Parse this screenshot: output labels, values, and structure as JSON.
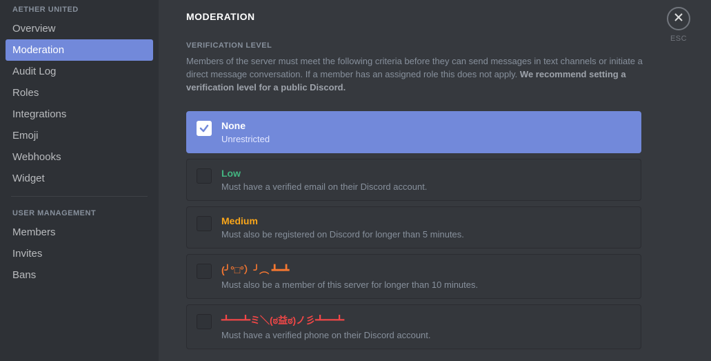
{
  "sidebar": {
    "header1": "AETHER UNITED",
    "items1": [
      "Overview",
      "Moderation",
      "Audit Log",
      "Roles",
      "Integrations",
      "Emoji",
      "Webhooks",
      "Widget"
    ],
    "activeIndex1": 1,
    "header2": "USER MANAGEMENT",
    "items2": [
      "Members",
      "Invites",
      "Bans"
    ]
  },
  "close": {
    "esc": "ESC"
  },
  "page": {
    "title": "MODERATION",
    "sectionTitle": "VERIFICATION LEVEL",
    "desc1": "Members of the server must meet the following criteria before they can send messages in text channels or initiate a direct message conversation. If a member has an assigned role this does not apply. ",
    "desc2": "We recommend setting a verification level for a public Discord."
  },
  "options": {
    "selectedIndex": 0,
    "list": [
      {
        "id": "none",
        "title": "None",
        "desc": "Unrestricted",
        "colorClass": "c-none"
      },
      {
        "id": "low",
        "title": "Low",
        "desc": "Must have a verified email on their Discord account.",
        "colorClass": "c-low"
      },
      {
        "id": "medium",
        "title": "Medium",
        "desc": "Must also be registered on Discord for longer than 5 minutes.",
        "colorClass": "c-med"
      },
      {
        "id": "high",
        "title": "(╯°□°）╯︵ ┻━┻",
        "desc": "Must also be a member of this server for longer than 10 minutes.",
        "colorClass": "c-high"
      },
      {
        "id": "extreme",
        "title": "┻━┻ミ＼(ಠ益ಠ)ノ彡┻━┻",
        "desc": "Must have a verified phone on their Discord account.",
        "colorClass": "c-ext"
      }
    ]
  }
}
